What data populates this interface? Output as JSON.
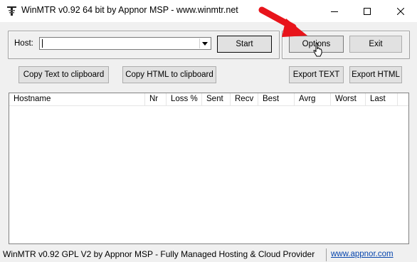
{
  "window": {
    "title": "WinMTR v0.92 64 bit by Appnor MSP - www.winmtr.net",
    "icon": "winmtr-app-icon"
  },
  "host": {
    "label": "Host:",
    "value": "",
    "placeholder": ""
  },
  "buttons": {
    "start": "Start",
    "options": "Options",
    "exit": "Exit",
    "copy_text": "Copy Text to clipboard",
    "copy_html": "Copy HTML to clipboard",
    "export_text": "Export TEXT",
    "export_html": "Export HTML"
  },
  "table": {
    "columns": [
      "Hostname",
      "Nr",
      "Loss %",
      "Sent",
      "Recv",
      "Best",
      "Avrg",
      "Worst",
      "Last"
    ],
    "rows": []
  },
  "statusbar": {
    "text": "WinMTR v0.92 GPL V2 by Appnor MSP - Fully Managed Hosting & Cloud Provider",
    "link": "www.appnor.com"
  },
  "annotation": {
    "arrow_color": "#e8141b"
  }
}
